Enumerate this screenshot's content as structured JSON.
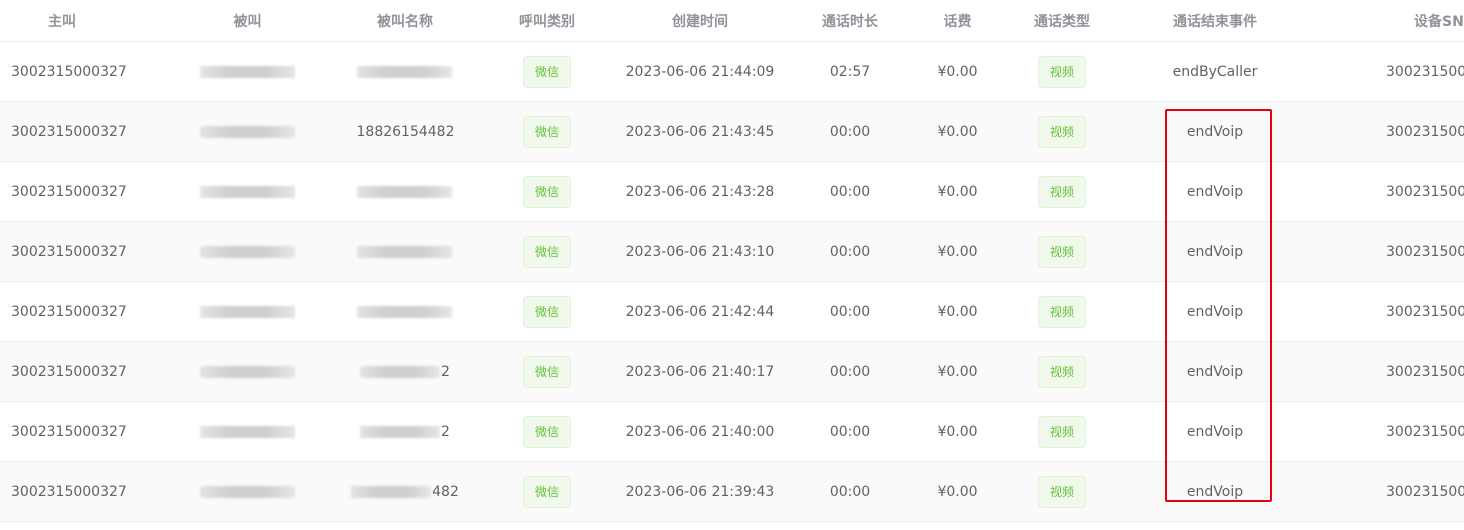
{
  "table": {
    "headers": [
      "主叫",
      "被叫",
      "被叫名称",
      "呼叫类别",
      "创建时间",
      "通话时长",
      "话费",
      "通话类型",
      "通话结束事件",
      "设备SN"
    ],
    "rows": [
      {
        "caller": "3002315000327",
        "callee_trail": "",
        "callee_name_trail": "",
        "category": "微信",
        "created": "2023-06-06 21:44:09",
        "duration": "02:57",
        "fee": "¥0.00",
        "call_type": "视频",
        "end_event": "endByCaller",
        "device_sn": "300231500"
      },
      {
        "caller": "3002315000327",
        "callee_trail": "",
        "callee_name_trail": "18826154482",
        "category": "微信",
        "created": "2023-06-06 21:43:45",
        "duration": "00:00",
        "fee": "¥0.00",
        "call_type": "视频",
        "end_event": "endVoip",
        "device_sn": "300231500"
      },
      {
        "caller": "3002315000327",
        "callee_trail": "",
        "callee_name_trail": "",
        "category": "微信",
        "created": "2023-06-06 21:43:28",
        "duration": "00:00",
        "fee": "¥0.00",
        "call_type": "视频",
        "end_event": "endVoip",
        "device_sn": "300231500"
      },
      {
        "caller": "3002315000327",
        "callee_trail": "",
        "callee_name_trail": "",
        "category": "微信",
        "created": "2023-06-06 21:43:10",
        "duration": "00:00",
        "fee": "¥0.00",
        "call_type": "视频",
        "end_event": "endVoip",
        "device_sn": "300231500"
      },
      {
        "caller": "3002315000327",
        "callee_trail": "",
        "callee_name_trail": "",
        "category": "微信",
        "created": "2023-06-06 21:42:44",
        "duration": "00:00",
        "fee": "¥0.00",
        "call_type": "视频",
        "end_event": "endVoip",
        "device_sn": "300231500"
      },
      {
        "caller": "3002315000327",
        "callee_trail": "",
        "callee_name_trail": "2",
        "category": "微信",
        "created": "2023-06-06 21:40:17",
        "duration": "00:00",
        "fee": "¥0.00",
        "call_type": "视频",
        "end_event": "endVoip",
        "device_sn": "300231500"
      },
      {
        "caller": "3002315000327",
        "callee_trail": "",
        "callee_name_trail": "2",
        "category": "微信",
        "created": "2023-06-06 21:40:00",
        "duration": "00:00",
        "fee": "¥0.00",
        "call_type": "视频",
        "end_event": "endVoip",
        "device_sn": "300231500"
      },
      {
        "caller": "3002315000327",
        "callee_trail": "",
        "callee_name_trail": "482",
        "category": "微信",
        "created": "2023-06-06 21:39:43",
        "duration": "00:00",
        "fee": "¥0.00",
        "call_type": "视频",
        "end_event": "endVoip",
        "device_sn": "300231500"
      }
    ]
  },
  "highlight": {
    "color": "#e60012",
    "target": "通话结束事件",
    "rows": "2-8"
  },
  "colors": {
    "tag_text": "#67c23a",
    "tag_bg": "#f0f9eb",
    "header_text": "#909399",
    "body_text": "#606266"
  }
}
